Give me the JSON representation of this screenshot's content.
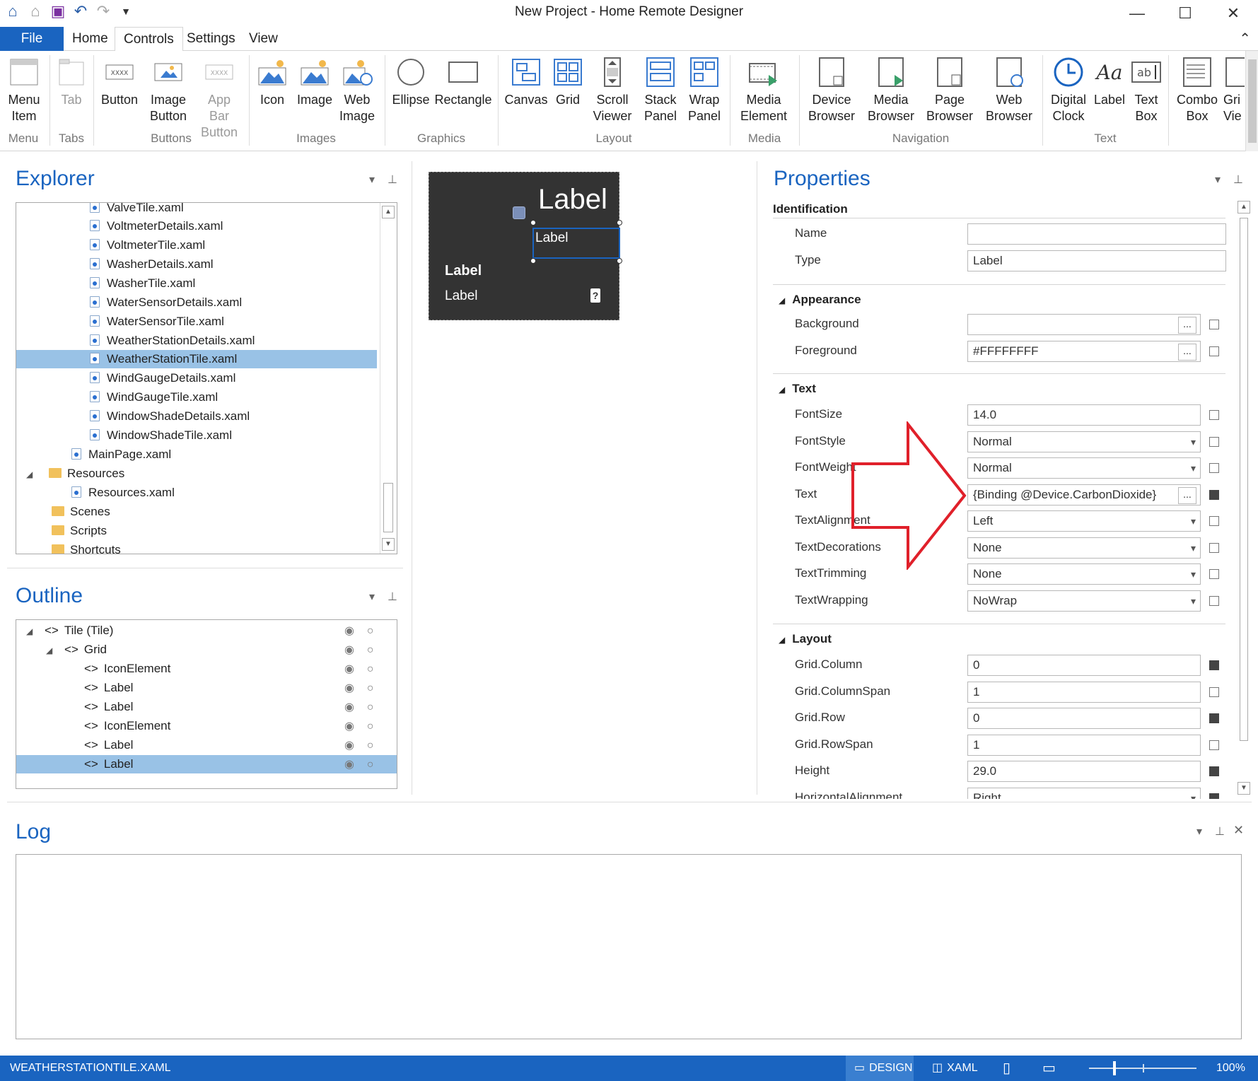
{
  "window": {
    "title": "New Project - Home Remote Designer",
    "minimize": "—",
    "maximize": "☐",
    "close": "✕"
  },
  "ribbon_tabs": [
    "File",
    "Home",
    "Controls",
    "Settings",
    "View"
  ],
  "ribbon": {
    "menu_item": "Menu Item",
    "tab": "Tab",
    "button": "Button",
    "image_button": "Image Button",
    "app_bar_button": "App Bar Button",
    "icon": "Icon",
    "image": "Image",
    "web_image": "Web Image",
    "ellipse": "Ellipse",
    "rectangle": "Rectangle",
    "canvas": "Canvas",
    "grid": "Grid",
    "scroll_viewer": "Scroll Viewer",
    "stack_panel": "Stack Panel",
    "wrap_panel": "Wrap Panel",
    "media_element": "Media Element",
    "device_browser": "Device Browser",
    "media_browser": "Media Browser",
    "page_browser": "Page Browser",
    "web_browser": "Web Browser",
    "digital_clock": "Digital Clock",
    "label": "Label",
    "text_box": "Text Box",
    "combo_box": "Combo Box",
    "grid_view": "Gri Vie",
    "groups": {
      "menu": "Menu",
      "tabs": "Tabs",
      "buttons": "Buttons",
      "images": "Images",
      "graphics": "Graphics",
      "layout": "Layout",
      "media": "Media",
      "navigation": "Navigation",
      "text": "Text"
    }
  },
  "explorer": {
    "title": "Explorer",
    "items": [
      "ValveTile.xaml",
      "VoltmeterDetails.xaml",
      "VoltmeterTile.xaml",
      "WasherDetails.xaml",
      "WasherTile.xaml",
      "WaterSensorDetails.xaml",
      "WaterSensorTile.xaml",
      "WeatherStationDetails.xaml",
      "WeatherStationTile.xaml",
      "WindGaugeDetails.xaml",
      "WindGaugeTile.xaml",
      "WindowShadeDetails.xaml",
      "WindowShadeTile.xaml",
      "MainPage.xaml",
      "Resources",
      "Resources.xaml",
      "Scenes",
      "Scripts",
      "Shortcuts"
    ]
  },
  "outline": {
    "title": "Outline",
    "items": [
      "Tile (Tile)",
      "Grid",
      "IconElement",
      "Label",
      "Label",
      "IconElement",
      "Label",
      "Label"
    ]
  },
  "canvas": {
    "big_label": "Label",
    "sel_label": "Label",
    "bold_label": "Label",
    "small_label": "Label"
  },
  "properties": {
    "title": "Properties",
    "identification": "Identification",
    "name_label": "Name",
    "name_value": "",
    "type_label": "Type",
    "type_value": "Label",
    "appearance": "Appearance",
    "background_label": "Background",
    "background_value": "",
    "foreground_label": "Foreground",
    "foreground_value": "#FFFFFFFF",
    "text_section": "Text",
    "fontsize_label": "FontSize",
    "fontsize_value": "14.0",
    "fontstyle_label": "FontStyle",
    "fontstyle_value": "Normal",
    "fontweight_label": "FontWeight",
    "fontweight_value": "Normal",
    "text_label": "Text",
    "text_value": "{Binding @Device.CarbonDioxide}",
    "textalignment_label": "TextAlignment",
    "textalignment_value": "Left",
    "textdecorations_label": "TextDecorations",
    "textdecorations_value": "None",
    "texttrimming_label": "TextTrimming",
    "texttrimming_value": "None",
    "textwrapping_label": "TextWrapping",
    "textwrapping_value": "NoWrap",
    "layout": "Layout",
    "gridcolumn_label": "Grid.Column",
    "gridcolumn_value": "0",
    "gridcolumnspan_label": "Grid.ColumnSpan",
    "gridcolumnspan_value": "1",
    "gridrow_label": "Grid.Row",
    "gridrow_value": "0",
    "gridrowspan_label": "Grid.RowSpan",
    "gridrowspan_value": "1",
    "height_label": "Height",
    "height_value": "29.0",
    "halign_label": "HorizontalAlignment",
    "halign_value": "Right",
    "ellipsis": "..."
  },
  "log": {
    "title": "Log"
  },
  "statusbar": {
    "file": "WEATHERSTATIONTILE.XAML",
    "design": "DESIGN",
    "xaml": "XAML",
    "zoom": "100%"
  },
  "colors": {
    "accent": "#1a64c0",
    "selection": "#99c2e6",
    "tile_bg": "#333333",
    "arrow": "#e0202a"
  }
}
